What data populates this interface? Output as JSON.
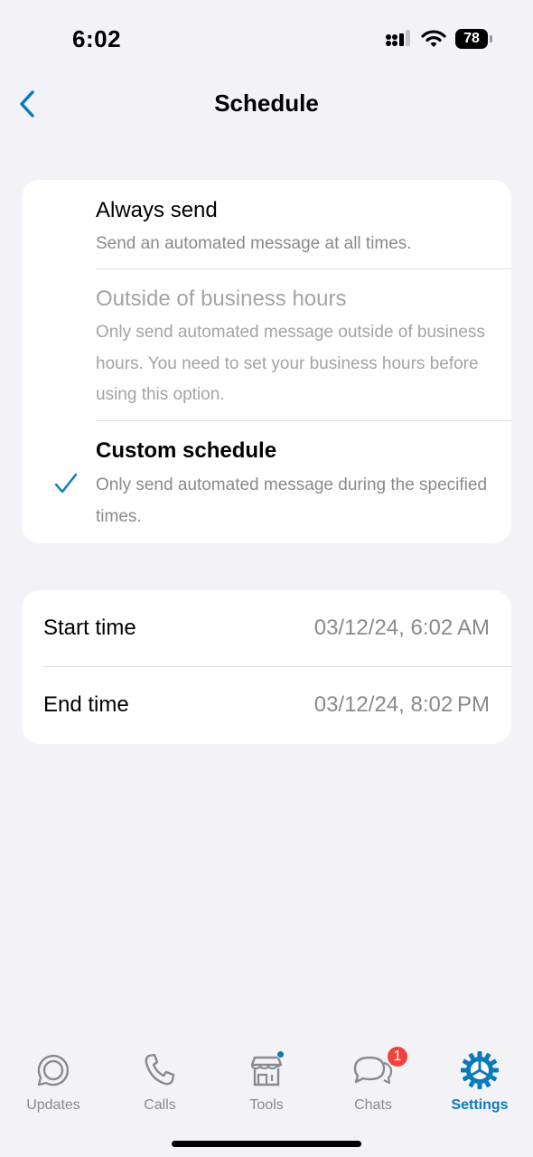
{
  "status": {
    "time": "6:02",
    "battery": "78"
  },
  "nav": {
    "title": "Schedule"
  },
  "options": [
    {
      "title": "Always send",
      "description": "Send an automated message at all times.",
      "state": "enabled"
    },
    {
      "title": "Outside of business hours",
      "description": "Only send automated message outside of business hours. You need to set your business hours before using this option.",
      "state": "disabled"
    },
    {
      "title": "Custom schedule",
      "description": "Only send automated message during the specified times.",
      "state": "selected"
    }
  ],
  "times": {
    "start": {
      "label": "Start time",
      "value": "03/12/24, 6:02 AM"
    },
    "end": {
      "label": "End time",
      "value": "03/12/24, 8:02 PM"
    }
  },
  "tabs": [
    {
      "label": "Updates",
      "icon": "updates-icon"
    },
    {
      "label": "Calls",
      "icon": "phone-icon"
    },
    {
      "label": "Tools",
      "icon": "storefront-icon"
    },
    {
      "label": "Chats",
      "icon": "chat-bubbles-icon",
      "badge": "1"
    },
    {
      "label": "Settings",
      "icon": "gear-icon",
      "active": true
    }
  ],
  "colors": {
    "accent": "#0a7bb9",
    "badge": "#f0433d",
    "background": "#f2f2f7"
  }
}
